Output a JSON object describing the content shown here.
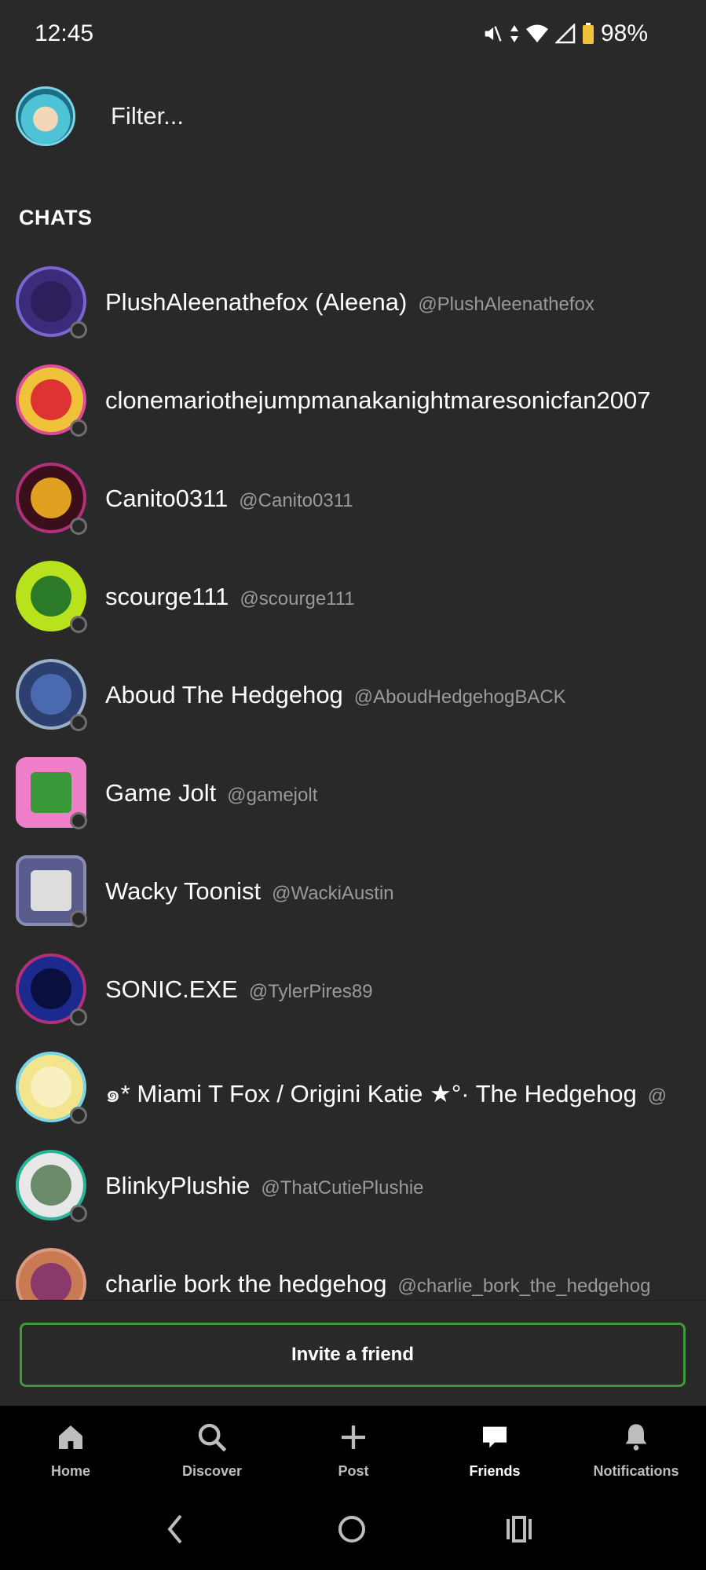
{
  "status_bar": {
    "time": "12:45",
    "battery": "98%",
    "icons": [
      "mute-icon",
      "data-arrows-icon",
      "wifi-icon",
      "cell-signal-icon",
      "battery-icon"
    ]
  },
  "filter": {
    "placeholder": "Filter..."
  },
  "section_title": "CHATS",
  "chats": [
    {
      "name": "PlushAleenathefox (Aleena)",
      "handle": "@PlushAleenathefox",
      "color": "#3c2a7a"
    },
    {
      "name": "clonemariothejumpmanakanightmaresonicfan2007",
      "handle": "",
      "color": "#f0c23a"
    },
    {
      "name": "Canito0311",
      "handle": "@Canito0311",
      "color": "#7a1e2e"
    },
    {
      "name": "scourge111",
      "handle": "@scourge111",
      "color": "#b8e21c"
    },
    {
      "name": "Aboud The Hedgehog",
      "handle": "@AboudHedgehogBACK",
      "color": "#2d3f6e"
    },
    {
      "name": "Game Jolt",
      "handle": "@gamejolt",
      "color": "#ee7fc8"
    },
    {
      "name": "Wacky Toonist",
      "handle": "@WackiAustin",
      "color": "#595c8a"
    },
    {
      "name": "SONIC.EXE",
      "handle": "@TylerPires89",
      "color": "#1b2a8c"
    },
    {
      "name": "๑* Miami T Fox / Origini Katie ★°· The Hedgehog",
      "handle": "@",
      "color": "#f3e58d"
    },
    {
      "name": "BlinkyPlushie",
      "handle": "@ThatCutiePlushie",
      "color": "#2bb49a"
    },
    {
      "name": "charlie bork the hedgehog",
      "handle": "@charlie_bork_the_hedgehog",
      "color": "#c97a52"
    }
  ],
  "invite_button": "Invite a friend",
  "bottom_nav": [
    {
      "label": "Home",
      "icon": "home-icon"
    },
    {
      "label": "Discover",
      "icon": "search-icon"
    },
    {
      "label": "Post",
      "icon": "plus-icon"
    },
    {
      "label": "Friends",
      "icon": "chat-bubble-icon"
    },
    {
      "label": "Notifications",
      "icon": "bell-icon"
    }
  ],
  "active_tab": "Friends",
  "accent_color": "#3f9a3a"
}
